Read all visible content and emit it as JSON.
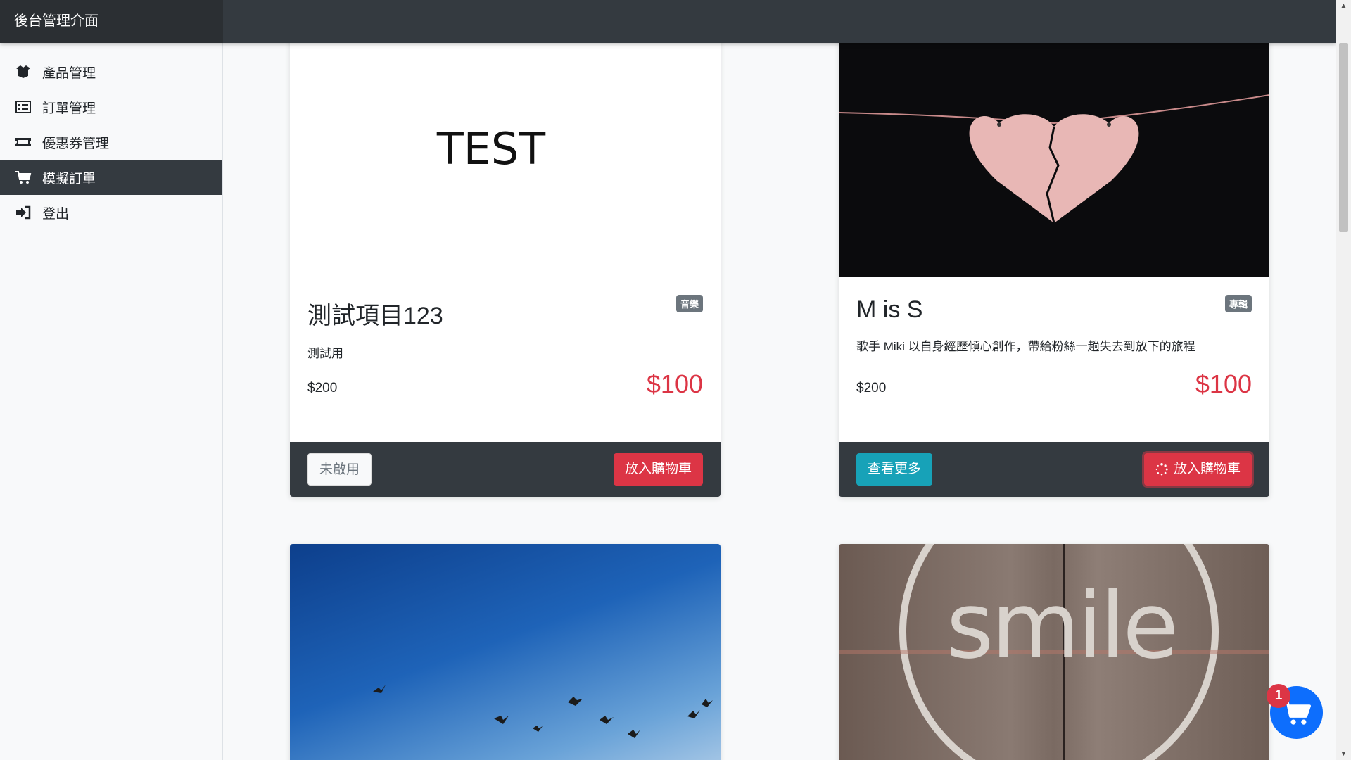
{
  "app": {
    "title": "後台管理介面"
  },
  "sidebar": {
    "items": [
      {
        "label": "產品管理",
        "icon": "box-open-icon",
        "active": false
      },
      {
        "label": "訂單管理",
        "icon": "list-icon",
        "active": false
      },
      {
        "label": "優惠券管理",
        "icon": "ticket-icon",
        "active": false
      },
      {
        "label": "模擬訂單",
        "icon": "cart-icon",
        "active": true
      },
      {
        "label": "登出",
        "icon": "sign-out-icon",
        "active": false
      }
    ]
  },
  "products": [
    {
      "title": "測試項目123",
      "category": "音樂",
      "description": "測試用",
      "original_price": "$200",
      "price": "$100",
      "image_text": "TEST",
      "more_button": "未啟用",
      "cart_button": "放入購物車"
    },
    {
      "title": "M is S",
      "category": "專輯",
      "description": "歌手 Miki 以自身經歷傾心創作，帶給粉絲一趟失去到放下的旅程",
      "original_price": "$200",
      "price": "$100",
      "image_text": "",
      "more_button": "查看更多",
      "cart_button": "放入購物車"
    },
    {
      "title": "",
      "image_text": ""
    },
    {
      "title": "",
      "image_text": "smile"
    }
  ],
  "cart": {
    "count": "1"
  },
  "colors": {
    "navbar": "#343a40",
    "danger": "#dc3545",
    "info": "#17a2b8",
    "primary": "#0d6efd"
  }
}
